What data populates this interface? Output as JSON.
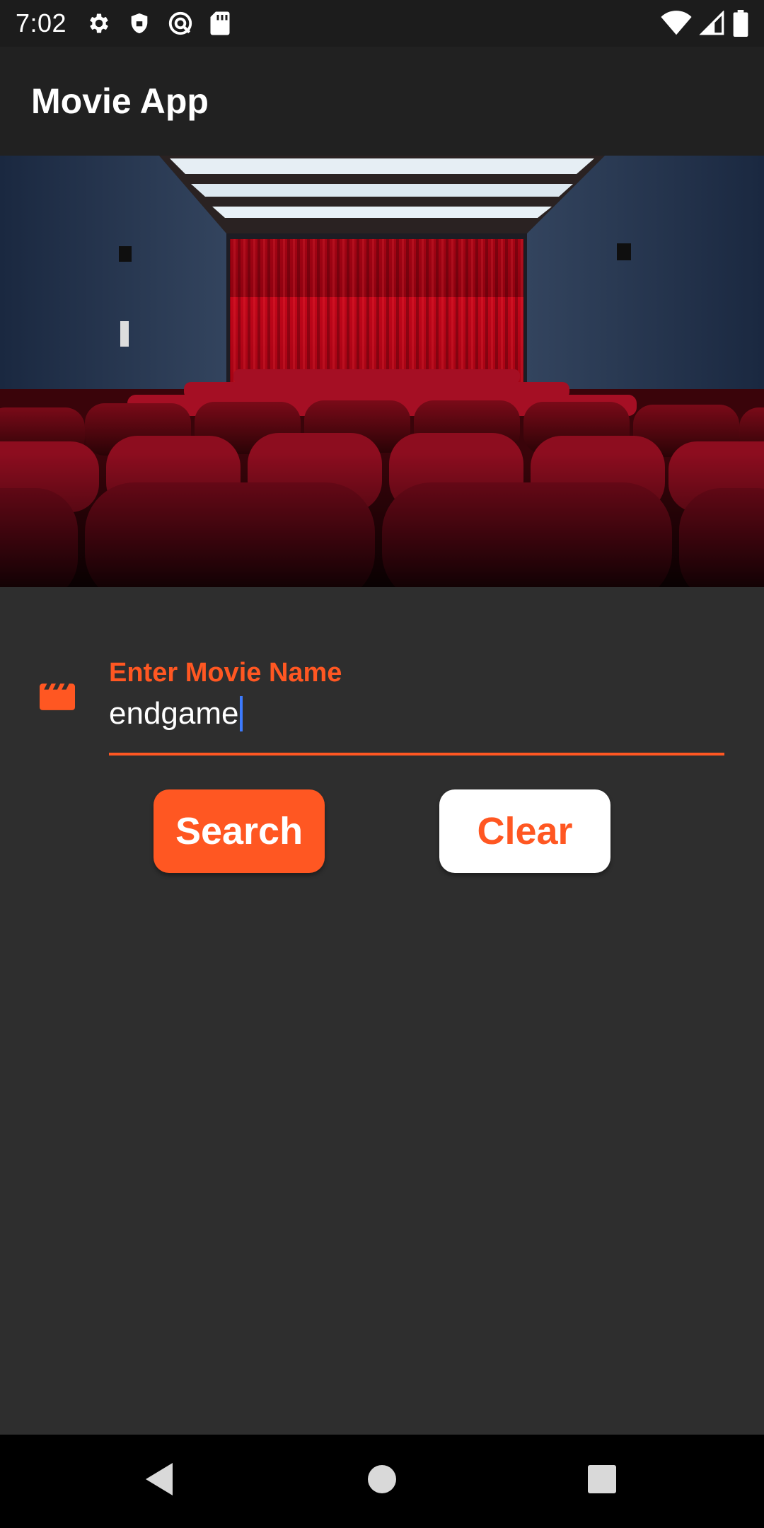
{
  "status_bar": {
    "time": "7:02",
    "left_icons": [
      "gear-icon",
      "shield-icon",
      "vpn-key-icon",
      "sd-card-icon"
    ],
    "right_icons": [
      "wifi-icon",
      "cell-signal-icon",
      "battery-icon"
    ]
  },
  "app_bar": {
    "title": "Movie App"
  },
  "hero": {
    "subject": "cinema-theater-image"
  },
  "form": {
    "icon": "movie-clapper-icon",
    "label": "Enter Movie Name",
    "value": "endgame",
    "accent": "#ff5722"
  },
  "buttons": {
    "search_label": "Search",
    "clear_label": "Clear"
  },
  "nav_bar": {
    "buttons": [
      "back-icon",
      "home-icon",
      "recents-icon"
    ]
  },
  "colors": {
    "background": "#2e2e2e",
    "app_bar": "#212121",
    "status_bar": "#1c1c1c",
    "accent": "#ff5722",
    "caret": "#3d7bff"
  }
}
